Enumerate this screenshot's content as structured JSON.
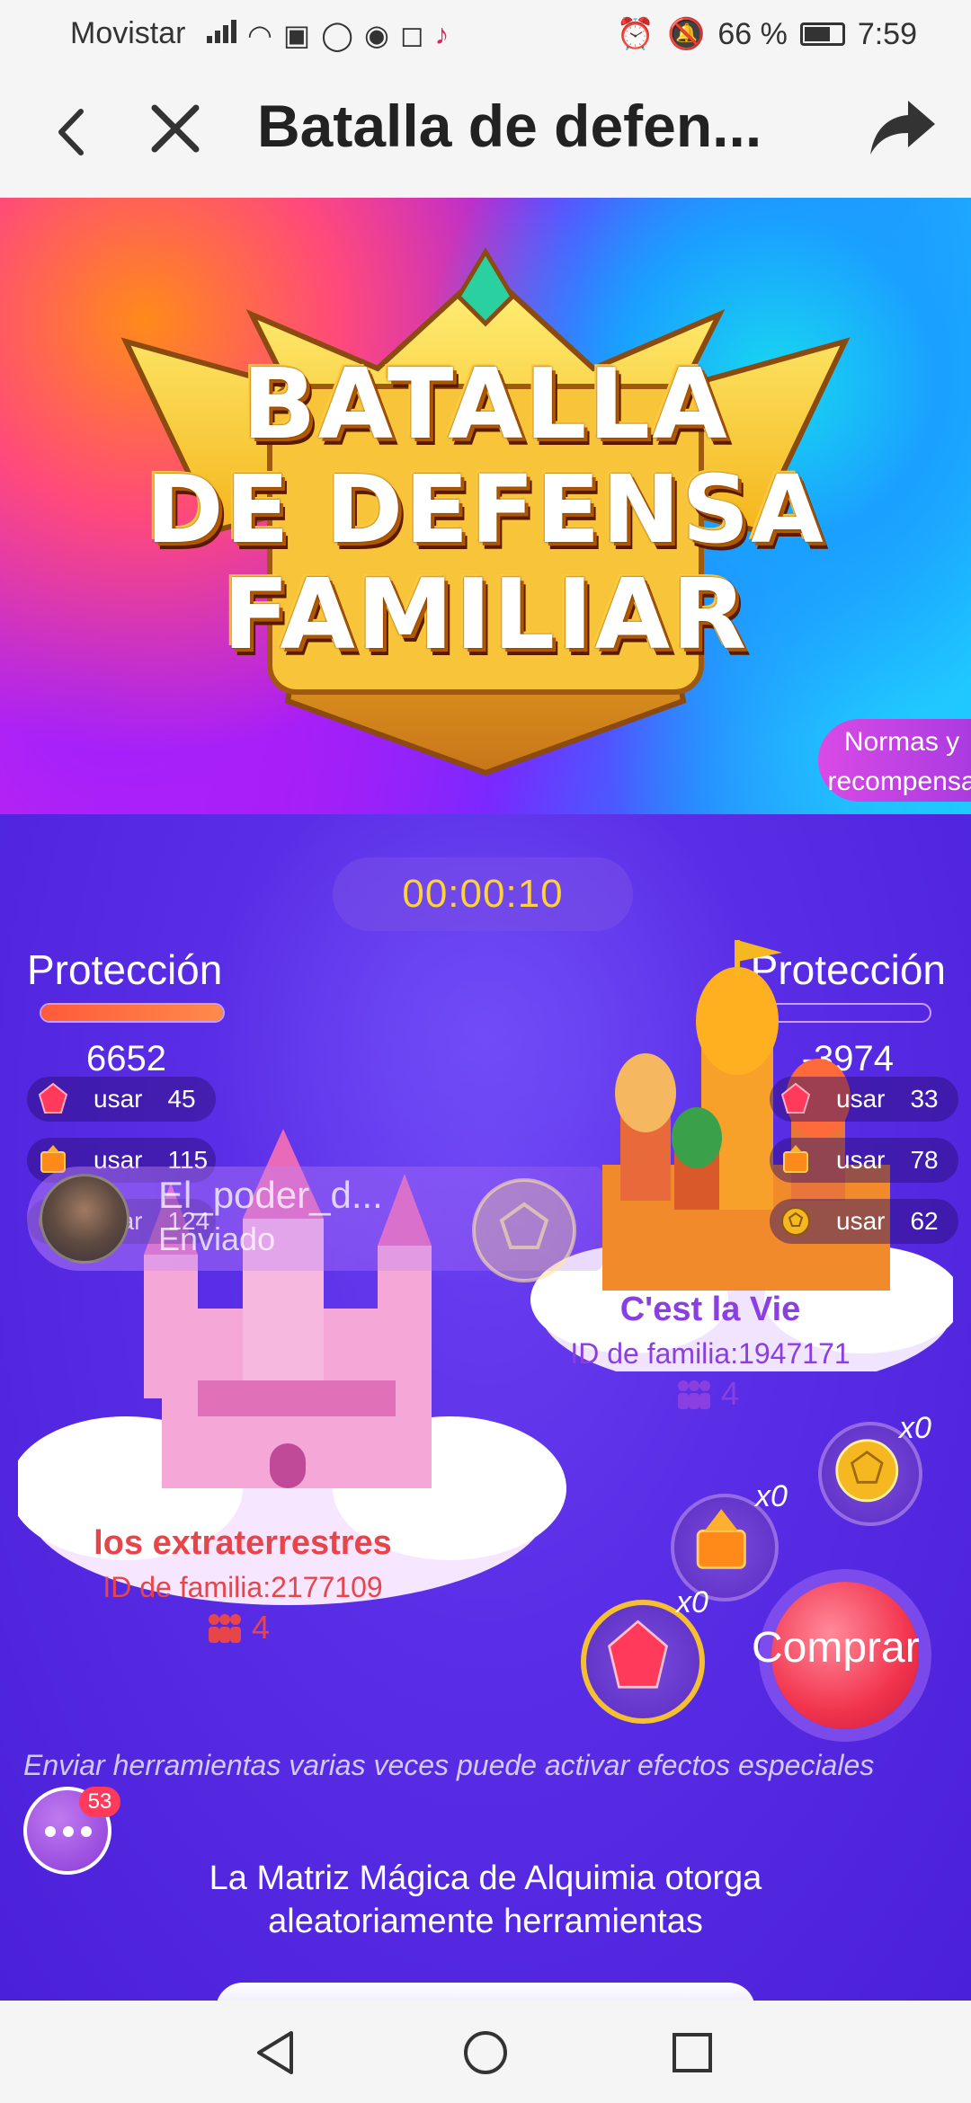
{
  "status_bar": {
    "carrier": "Movistar",
    "battery": "66 %",
    "time": "7:59"
  },
  "header": {
    "title": "Batalla de defen..."
  },
  "banner": {
    "line1": "BATALLA",
    "line2": "DE DEFENSA",
    "line3": "FAMILIAR",
    "rules_button": "Normas y recompensa"
  },
  "battle": {
    "timer": "00:00:10",
    "left": {
      "protection_label": "Protección",
      "protection_fill": 1.0,
      "score": "6652",
      "tools": [
        {
          "label": "usar",
          "count": "45",
          "icon": "red-crystal-icon"
        },
        {
          "label": "usar",
          "count": "115",
          "icon": "fire-book-icon"
        },
        {
          "label": "usar",
          "count": "124",
          "icon": "gold-ball-icon"
        }
      ],
      "team_name": "los extraterrestres",
      "family_id": "ID de familia:2177109",
      "members": "4"
    },
    "right": {
      "protection_label": "Protección",
      "protection_fill": 0.0,
      "score": "-3974",
      "tools": [
        {
          "label": "usar",
          "count": "33",
          "icon": "red-crystal-icon"
        },
        {
          "label": "usar",
          "count": "78",
          "icon": "fire-book-icon"
        },
        {
          "label": "usar",
          "count": "62",
          "icon": "gold-ball-icon"
        }
      ],
      "team_name": "C'est la Vie",
      "family_id": "ID de familia:1947171",
      "members": "4"
    },
    "sent": {
      "user": "El_poder_d...",
      "status": "Enviado"
    },
    "inventory": {
      "ball_count": "x0",
      "book_count": "x0",
      "crystal_count": "x0"
    },
    "buy_button": "Comprar",
    "hint": "Enviar herramientas varias veces puede activar efectos especiales",
    "chat_badge": "53",
    "alchemy_line1": "La Matriz Mágica de Alquimia otorga",
    "alchemy_line2": "aleatoriamente herramientas"
  },
  "colors": {
    "accent_timer": "#ffd23a",
    "left_team": "#e8454a",
    "right_team": "#8a3fe0",
    "buy": "#f2344e"
  }
}
